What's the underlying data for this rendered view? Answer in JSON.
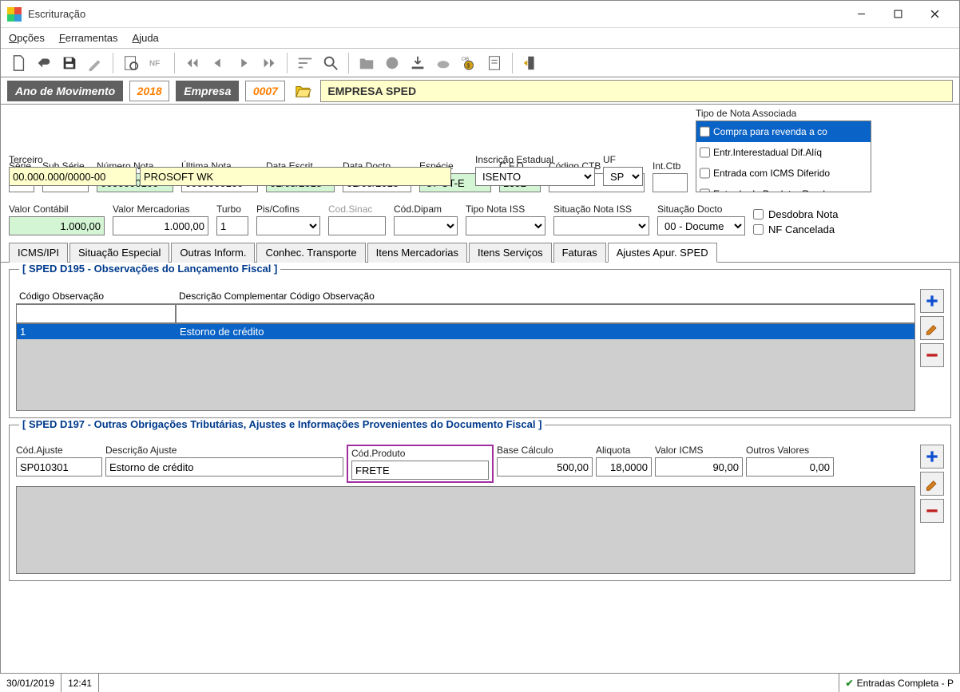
{
  "window": {
    "title": "Escrituração"
  },
  "menu": {
    "opcoes": "Opções",
    "ferramentas": "Ferramentas",
    "ajuda": "Ajuda"
  },
  "infobar": {
    "ano_label": "Ano de Movimento",
    "ano_value": "2018",
    "empresa_label": "Empresa",
    "empresa_code": "0007",
    "empresa_name": "EMPRESA SPED"
  },
  "row1": {
    "serie_label": "Série",
    "subserie_label": "Sub Série",
    "numnota_label": "Número Nota",
    "numnota_value": "0000000100",
    "ultnota_label": "Última Nota",
    "ultnota_value": "0000000100",
    "dataescrit_label": "Data Escrit.",
    "dataescrit_value": "01/08/2018",
    "datadocto_label": "Data Docto.",
    "datadocto_value": "01/08/2018",
    "especie_label": "Espécie",
    "especie_value": "57   CT-E",
    "cfo_label": "C.F.O.",
    "cfo_value": "1352",
    "codctb_label": "Código CTB",
    "codctb_value": "",
    "intctb_label": "Int.Ctb",
    "intctb_value": "",
    "tiponota_label": "Tipo de Nota Associada",
    "tiponota_items": [
      "Compra para revenda a co",
      "Entr.Interestadual Dif.Alíq",
      "Entrada com ICMS Diferido",
      "Entrada de Produtor Rural"
    ]
  },
  "row2": {
    "terceiro_label": "Terceiro",
    "terceiro_doc": "00.000.000/0000-00",
    "terceiro_nome": "PROSOFT WK",
    "inscest_label": "Inscrição Estadual",
    "inscest_value": "ISENTO",
    "uf_label": "UF",
    "uf_value": "SP"
  },
  "row3": {
    "valcont_label": "Valor Contábil",
    "valcont_value": "1.000,00",
    "valmerc_label": "Valor Mercadorias",
    "valmerc_value": "1.000,00",
    "turbo_label": "Turbo",
    "turbo_value": "1",
    "piscofins_label": "Pis/Cofins",
    "piscofins_value": "",
    "codsinac_label": "Cod.Sinac",
    "codsinac_value": "",
    "coddipam_label": "Cód.Dipam",
    "coddipam_value": "",
    "tiponotaiss_label": "Tipo Nota ISS",
    "tiponotaiss_value": "",
    "sitnotaiss_label": "Situação Nota ISS",
    "sitnotaiss_value": "",
    "sitdocto_label": "Situação Docto",
    "sitdocto_value": "00 - Docume",
    "desdobra_label": "Desdobra Nota",
    "nfcanc_label": "NF Cancelada"
  },
  "tabs": [
    "ICMS/IPI",
    "Situação Especial",
    "Outras Inform.",
    "Conhec. Transporte",
    "Itens Mercadorias",
    "Itens Serviços",
    "Faturas",
    "Ajustes Apur. SPED"
  ],
  "d195": {
    "legend": "[ SPED D195 - Observações do Lançamento Fiscal ]",
    "col1": "Código Observação",
    "col2": "Descrição Complementar Código Observação",
    "row": {
      "codigo": "1",
      "descricao": "Estorno de crédito"
    }
  },
  "d197": {
    "legend": "[ SPED D197 - Outras Obrigações Tributárias, Ajustes e Informações Provenientes do Documento Fiscal  ]",
    "cols": {
      "codajuste": "Cód.Ajuste",
      "descajuste": "Descrição Ajuste",
      "codproduto": "Cód.Produto",
      "basecalc": "Base Cálculo",
      "aliquota": "Aliquota",
      "valoricms": "Valor ICMS",
      "outrosval": "Outros Valores"
    },
    "vals": {
      "codajuste": "SP010301",
      "descajuste": "Estorno de crédito",
      "codproduto": "FRETE",
      "basecalc": "500,00",
      "aliquota": "18,0000",
      "valoricms": "90,00",
      "outrosval": "0,00"
    }
  },
  "status": {
    "date": "30/01/2019",
    "time": "12:41",
    "mode": "Entradas Completa - P"
  }
}
